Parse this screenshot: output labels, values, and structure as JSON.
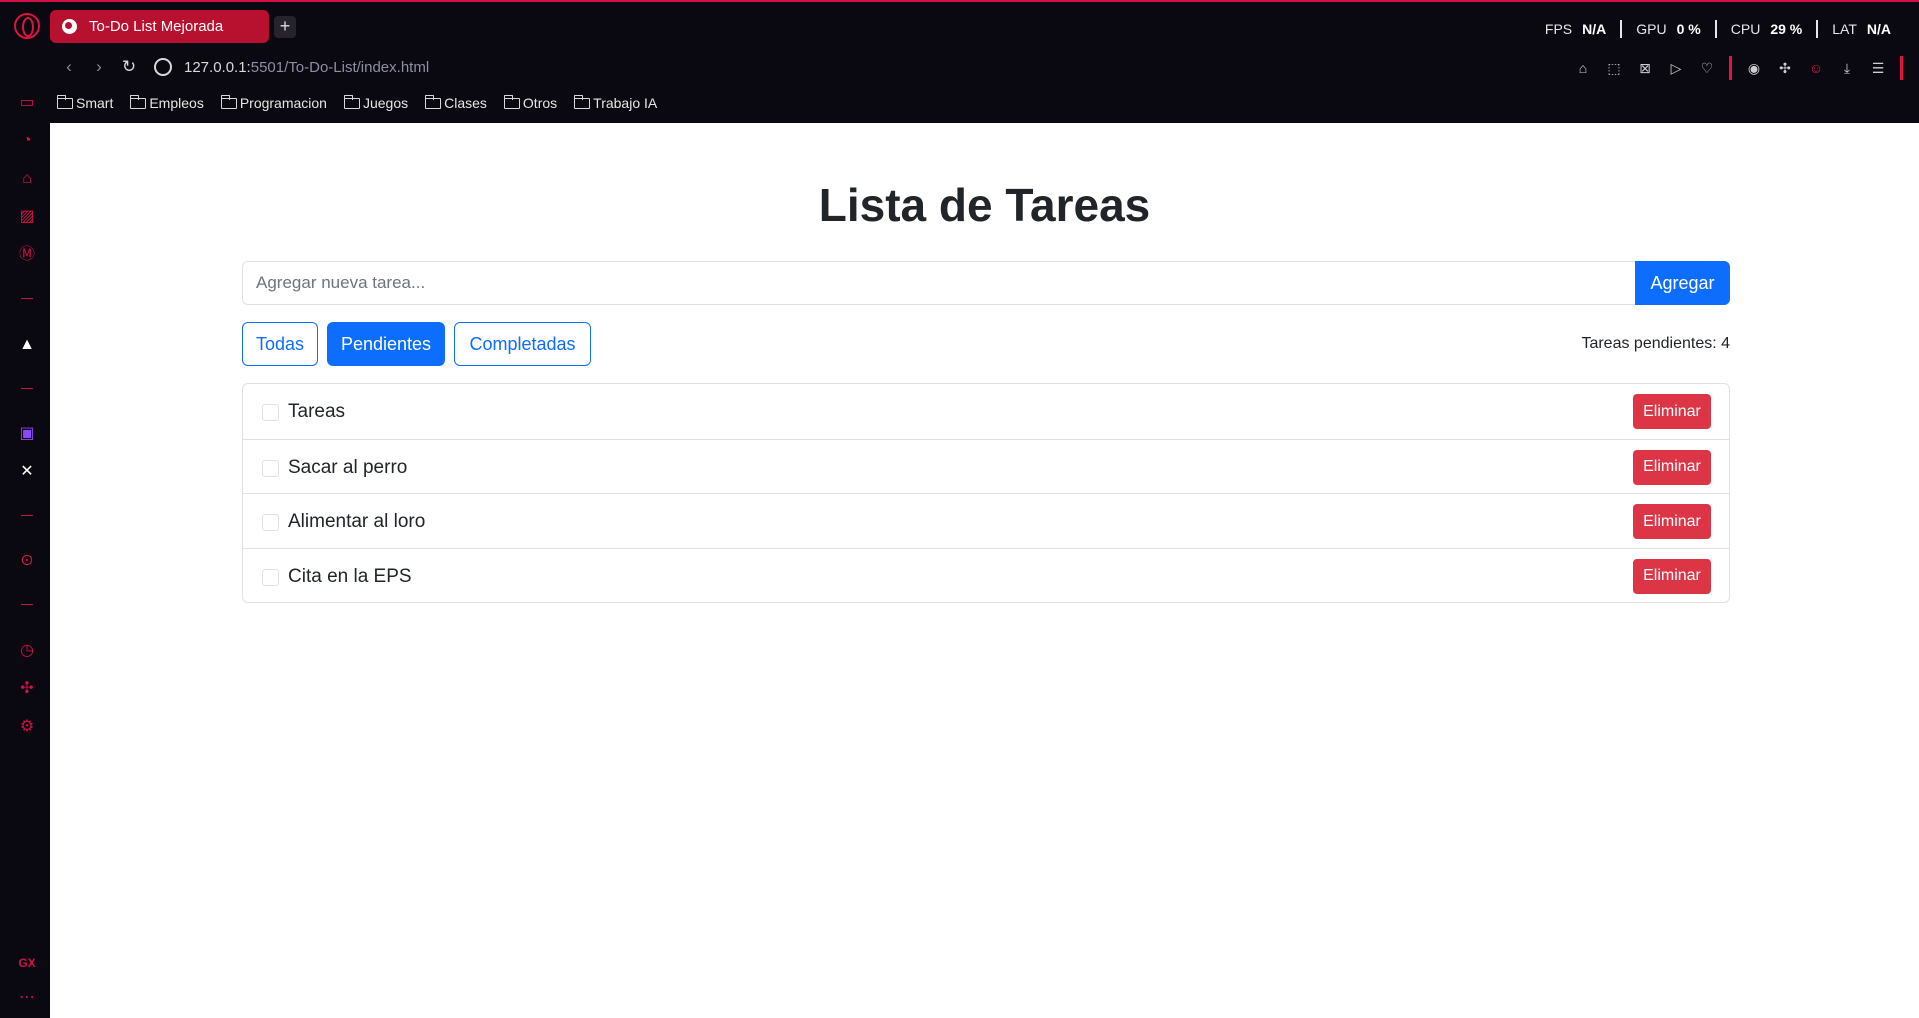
{
  "browser": {
    "tab_title": "To-Do List Mejorada",
    "new_tab_label": "+",
    "hud": {
      "fps_label": "FPS",
      "fps_value": "N/A",
      "gpu_label": "GPU",
      "gpu_value": "0 %",
      "cpu_label": "CPU",
      "cpu_value": "29 %",
      "lat_label": "LAT",
      "lat_value": "N/A"
    },
    "url_host": "127.0.0.1:",
    "url_path": "5501/To-Do-List/index.html",
    "bookmarks": [
      "Smart",
      "Empleos",
      "Programacion",
      "Juegos",
      "Clases",
      "Otros",
      "Trabajo IA"
    ],
    "sidebar_bottom_label": "GX",
    "accent_color": "#d40f45"
  },
  "app": {
    "title": "Lista de Tareas",
    "input_placeholder": "Agregar nueva tarea...",
    "add_button": "Agregar",
    "filters": [
      "Todas",
      "Pendientes",
      "Completadas"
    ],
    "active_filter": "Pendientes",
    "pending_label": "Tareas pendientes: 4",
    "tasks": [
      {
        "text": "Tareas",
        "completed": false
      },
      {
        "text": "Sacar al perro",
        "completed": false
      },
      {
        "text": "Alimentar al loro",
        "completed": false
      },
      {
        "text": "Cita en la EPS",
        "completed": false
      }
    ],
    "delete_label": "Eliminar",
    "primary_color": "#0d6efd",
    "danger_color": "#dc3545"
  }
}
